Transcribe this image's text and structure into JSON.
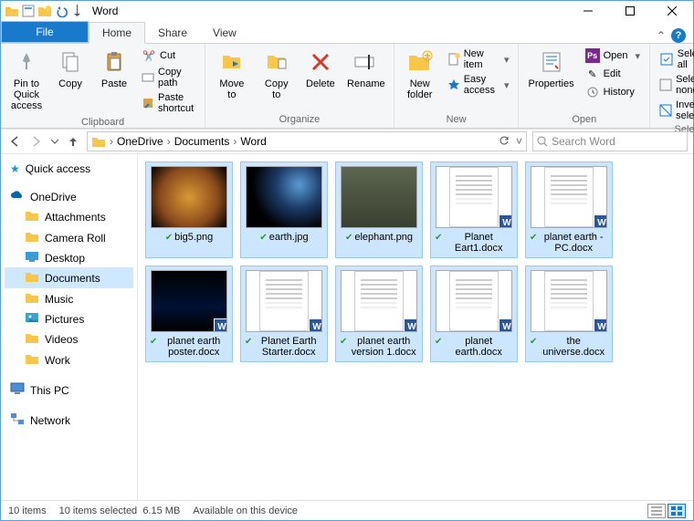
{
  "window_title": "Word",
  "tabs": {
    "file": "File",
    "home": "Home",
    "share": "Share",
    "view": "View"
  },
  "ribbon": {
    "clipboard": {
      "label": "Clipboard",
      "pin": "Pin to Quick access",
      "copy": "Copy",
      "paste": "Paste",
      "cut": "Cut",
      "copypath": "Copy path",
      "pasteshortcut": "Paste shortcut"
    },
    "organize": {
      "label": "Organize",
      "move": "Move to",
      "copy": "Copy to",
      "delete": "Delete",
      "rename": "Rename"
    },
    "new": {
      "label": "New",
      "newfolder": "New folder",
      "newitem": "New item",
      "easyaccess": "Easy access"
    },
    "open": {
      "label": "Open",
      "properties": "Properties",
      "open": "Open",
      "edit": "Edit",
      "history": "History"
    },
    "select": {
      "label": "Select",
      "selectall": "Select all",
      "selectnone": "Select none",
      "invert": "Invert selection"
    }
  },
  "breadcrumbs": [
    "OneDrive",
    "Documents",
    "Word"
  ],
  "refresh_tip": "Refresh",
  "search_placeholder": "Search Word",
  "nav": {
    "quick": "Quick access",
    "onedrive": "OneDrive",
    "onedrive_children": [
      "Attachments",
      "Camera Roll",
      "Desktop",
      "Documents",
      "Music",
      "Pictures",
      "Videos",
      "Work"
    ],
    "thispc": "This PC",
    "network": "Network"
  },
  "files": [
    {
      "name": "big5.png",
      "kind": "img",
      "thumb": "th-big5"
    },
    {
      "name": "earth.jpg",
      "kind": "img",
      "thumb": "th-earth"
    },
    {
      "name": "elephant.png",
      "kind": "img",
      "thumb": "th-eleph"
    },
    {
      "name": "Planet Eart1.docx",
      "kind": "docx"
    },
    {
      "name": "planet earth - PC.docx",
      "kind": "docx"
    },
    {
      "name": "planet earth poster.docx",
      "kind": "docx",
      "thumb": "th-poster"
    },
    {
      "name": "Planet Earth Starter.docx",
      "kind": "docx"
    },
    {
      "name": "planet earth version 1.docx",
      "kind": "docx"
    },
    {
      "name": "planet earth.docx",
      "kind": "docx"
    },
    {
      "name": "the universe.docx",
      "kind": "docx"
    }
  ],
  "status": {
    "count": "10 items",
    "selected": "10 items selected",
    "size": "6.15 MB",
    "availability": "Available on this device"
  }
}
